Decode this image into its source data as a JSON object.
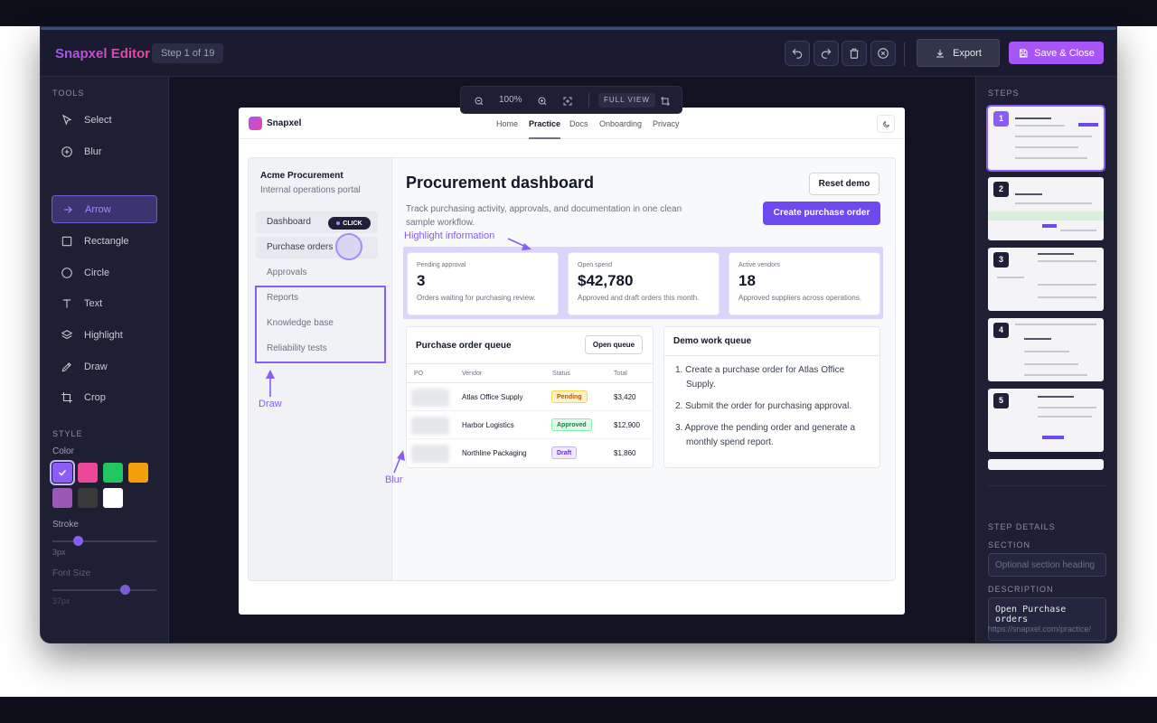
{
  "header": {
    "brand": "Snapxel Editor",
    "step_indicator": "Step 1 of 19",
    "export_label": "Export",
    "save_label": "Save & Close"
  },
  "tools": {
    "section_title": "TOOLS",
    "items": [
      {
        "label": "Select",
        "icon": "cursor-icon"
      },
      {
        "label": "Blur",
        "icon": "blur-icon"
      },
      {
        "label": "Arrow",
        "icon": "arrow-right-icon",
        "active": true
      },
      {
        "label": "Rectangle",
        "icon": "square-icon"
      },
      {
        "label": "Circle",
        "icon": "circle-icon"
      },
      {
        "label": "Text",
        "icon": "text-icon"
      },
      {
        "label": "Highlight",
        "icon": "layers-icon"
      },
      {
        "label": "Draw",
        "icon": "pen-icon"
      },
      {
        "label": "Crop",
        "icon": "crop-icon"
      }
    ]
  },
  "style": {
    "section_title": "STYLE",
    "color_label": "Color",
    "colors": [
      "#8b5cf6",
      "#ec4899",
      "#22c55e",
      "#f59e0b",
      "#9b59b6",
      "#3a3a3a",
      "#ffffff"
    ],
    "selected_color": "#8b5cf6",
    "stroke_label": "Stroke",
    "stroke_value": "3px",
    "stroke_level": 0.25,
    "font_size_label": "Font Size",
    "font_size_value": "37px",
    "font_size_level": 0.7
  },
  "zoom": {
    "level": "100%",
    "full_view_label": "FULL VIEW"
  },
  "preview": {
    "brand": "Snapxel",
    "nav": [
      "Home",
      "Practice",
      "Docs",
      "Onboarding",
      "Privacy"
    ],
    "active_nav": "Practice",
    "org_name": "Acme Procurement",
    "org_sub": "Internal operations portal",
    "sidebar": [
      "Dashboard",
      "Purchase orders",
      "Approvals",
      "Reports",
      "Knowledge base",
      "Reliability tests"
    ],
    "title": "Procurement dashboard",
    "description": "Track purchasing activity, approvals, and documentation in one clean sample workflow.",
    "reset_label": "Reset demo",
    "create_label": "Create purchase order",
    "stats": [
      {
        "label": "Pending approval",
        "value": "3",
        "sub": "Orders waiting for purchasing review."
      },
      {
        "label": "Open spend",
        "value": "$42,780",
        "sub": "Approved and draft orders this month."
      },
      {
        "label": "Active vendors",
        "value": "18",
        "sub": "Approved suppliers across operations."
      }
    ],
    "queue": {
      "title": "Purchase order queue",
      "open_label": "Open queue",
      "columns": [
        "PO",
        "Vendor",
        "Status",
        "Total"
      ],
      "rows": [
        {
          "vendor": "Atlas Office Supply",
          "status": "Pending",
          "total": "$3,420"
        },
        {
          "vendor": "Harbor Logistics",
          "status": "Approved",
          "total": "$12,900"
        },
        {
          "vendor": "Northline Packaging",
          "status": "Draft",
          "total": "$1,860"
        }
      ]
    },
    "work_queue": {
      "title": "Demo work queue",
      "items": [
        "1. Create a purchase order for Atlas Office Supply.",
        "2. Submit the order for purchasing approval.",
        "3. Approve the pending order and generate a monthly spend report."
      ]
    }
  },
  "annotations": {
    "highlight_label": "Highlight information",
    "click_label": "CLICK",
    "draw_label": "Draw",
    "blur_label": "Blur"
  },
  "steps": {
    "section_title": "STEPS",
    "numbers": [
      "1",
      "2",
      "3",
      "4",
      "5"
    ]
  },
  "step_details": {
    "section_title": "STEP DETAILS",
    "section_label": "SECTION",
    "section_placeholder": "Optional section heading",
    "description_label": "DESCRIPTION",
    "description_value": "Open Purchase orders",
    "url": "https://snapxel.com/practice/"
  }
}
